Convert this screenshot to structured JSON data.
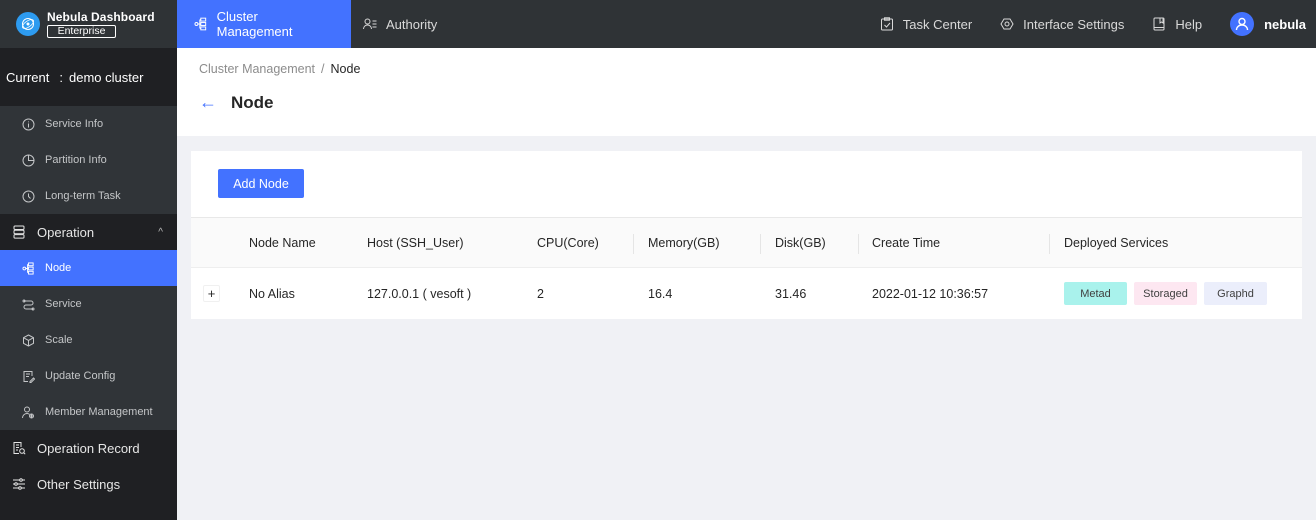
{
  "app": {
    "logo_title": "Nebula Dashboard",
    "logo_badge": "Enterprise"
  },
  "topnav": {
    "left": [
      {
        "label": "Cluster Management",
        "icon": "cluster-icon",
        "active": true
      },
      {
        "label": "Authority",
        "icon": "authority-icon",
        "active": false
      }
    ],
    "right": [
      {
        "label": "Task Center",
        "icon": "clipboard-check-icon"
      },
      {
        "label": "Interface Settings",
        "icon": "eye-settings-icon"
      },
      {
        "label": "Help",
        "icon": "book-icon"
      }
    ],
    "user": {
      "name": "nebula",
      "icon": "user-icon"
    }
  },
  "sidebar": {
    "current_label": "Current",
    "current_sep": ":",
    "current_cluster": "demo cluster",
    "info_items": [
      {
        "label": "Service Info",
        "icon": "info-icon"
      },
      {
        "label": "Partition Info",
        "icon": "pie-icon"
      },
      {
        "label": "Long-term Task",
        "icon": "clock-icon"
      }
    ],
    "operation": {
      "label": "Operation",
      "icon": "server-icon",
      "expanded": true,
      "chevron": "chevron-up-icon"
    },
    "operation_items": [
      {
        "label": "Node",
        "icon": "node-icon",
        "active": true
      },
      {
        "label": "Service",
        "icon": "service-icon"
      },
      {
        "label": "Scale",
        "icon": "cube-icon"
      },
      {
        "label": "Update Config",
        "icon": "edit-doc-icon"
      },
      {
        "label": "Member Management",
        "icon": "member-icon"
      }
    ],
    "bottom_items": [
      {
        "label": "Operation Record",
        "icon": "record-icon"
      },
      {
        "label": "Other Settings",
        "icon": "sliders-icon"
      }
    ]
  },
  "breadcrumb": {
    "parent": "Cluster Management",
    "separator": "/",
    "current": "Node"
  },
  "page": {
    "title": "Node",
    "add_button": "Add Node"
  },
  "table": {
    "columns": [
      "Node Name",
      "Host (SSH_User)",
      "CPU(Core)",
      "Memory(GB)",
      "Disk(GB)",
      "Create Time",
      "Deployed Services"
    ],
    "rows": [
      {
        "expand": "+",
        "node_name": "No Alias",
        "host": "127.0.0.1 ( vesoft )",
        "cpu": "2",
        "memory": "16.4",
        "disk": "31.46",
        "create_time": "2022-01-12 10:36:57",
        "services": [
          {
            "label": "Metad",
            "color": "#a9f2ec"
          },
          {
            "label": "Storaged",
            "color": "#fde7f1"
          },
          {
            "label": "Graphd",
            "color": "#ebeefb"
          }
        ]
      }
    ]
  },
  "colors": {
    "accent": "#4372ff",
    "topbar": "#2f3336",
    "sidebar": "#1f2023",
    "subnav": "#303438"
  }
}
